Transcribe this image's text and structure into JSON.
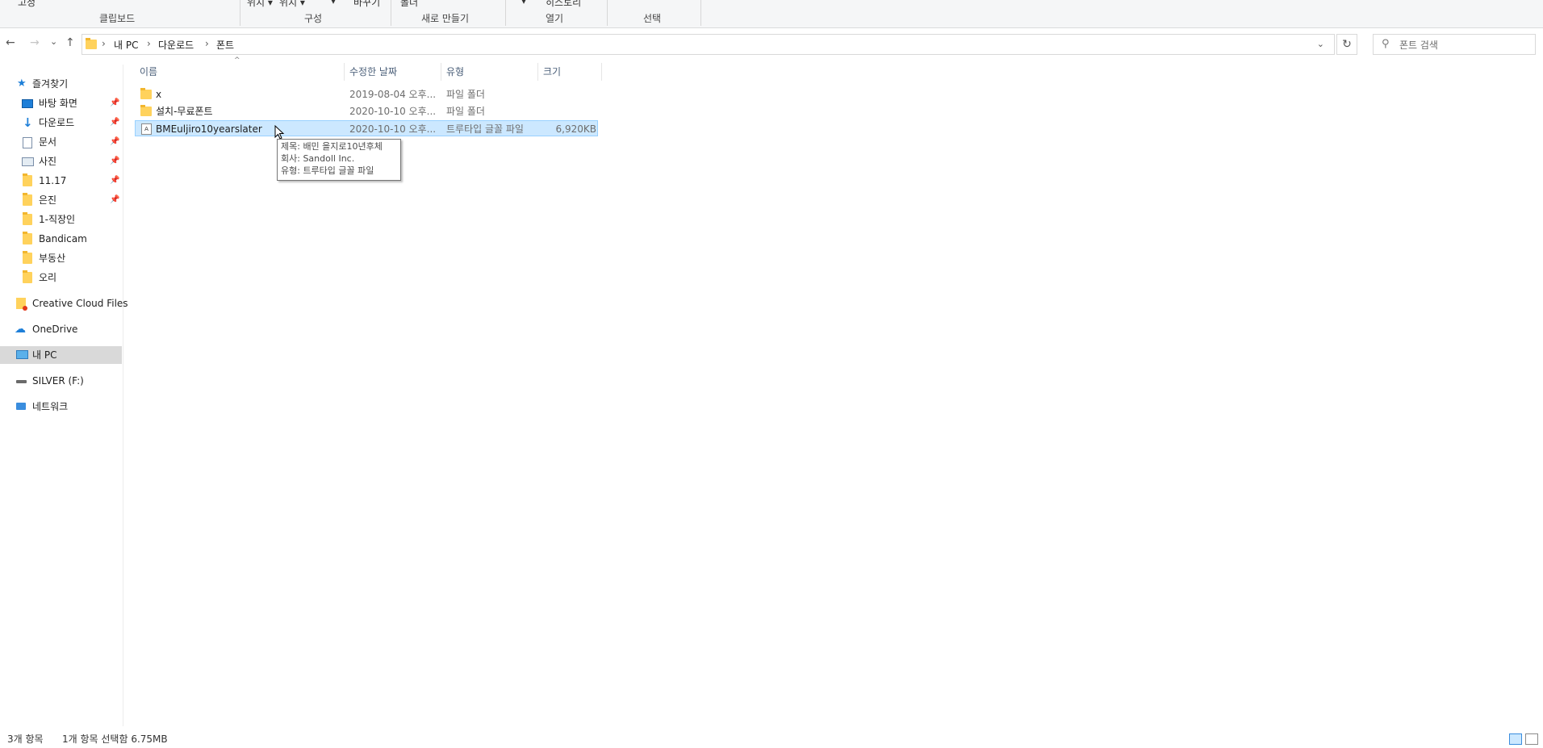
{
  "ribbon": {
    "top_items": [
      "고정",
      "위치 ▾",
      "위치 ▾",
      "▾",
      "바꾸기",
      "폴더",
      "▾",
      "히스토리"
    ],
    "groups": [
      {
        "label": "클립보드"
      },
      {
        "label": "구성"
      },
      {
        "label": "새로 만들기"
      },
      {
        "label": "열기"
      },
      {
        "label": "선택"
      }
    ]
  },
  "nav": {
    "back_icon": "←",
    "forward_icon": "→",
    "recent_icon": "⌄",
    "up_icon": "↑",
    "refresh_icon": "↻"
  },
  "address": {
    "crumbs": [
      "내 PC",
      "다운로드",
      "폰트"
    ],
    "separator": "›"
  },
  "search": {
    "placeholder": "폰트 검색",
    "value": ""
  },
  "sidebar": {
    "quick_access": "즐겨찾기",
    "items": [
      {
        "label": "바탕 화면",
        "icon": "desktop-icon",
        "pinned": true
      },
      {
        "label": "다운로드",
        "icon": "download-icon",
        "pinned": true
      },
      {
        "label": "문서",
        "icon": "document-icon",
        "pinned": true
      },
      {
        "label": "사진",
        "icon": "picture-icon",
        "pinned": true
      },
      {
        "label": "11.17",
        "icon": "folder-icon",
        "pinned": true
      },
      {
        "label": "은진",
        "icon": "folder-icon",
        "pinned": true
      },
      {
        "label": "1-직장인",
        "icon": "folder-icon",
        "pinned": false
      },
      {
        "label": "Bandicam",
        "icon": "folder-icon",
        "pinned": false
      },
      {
        "label": "부동산",
        "icon": "folder-icon",
        "pinned": false
      },
      {
        "label": "오리",
        "icon": "folder-icon",
        "pinned": false
      }
    ],
    "creative_cloud": "Creative Cloud Files",
    "onedrive": "OneDrive",
    "this_pc": "내 PC",
    "drive": "SILVER (F:)",
    "network": "네트워크"
  },
  "columns": {
    "name": "이름",
    "modified": "수정한 날짜",
    "type": "유형",
    "size": "크기"
  },
  "files": [
    {
      "name": "x",
      "modified": "2019-08-04 오후...",
      "type": "파일 폴더",
      "size": "",
      "kind": "folder",
      "selected": false
    },
    {
      "name": "설치-무료폰트",
      "modified": "2020-10-10 오후...",
      "type": "파일 폴더",
      "size": "",
      "kind": "folder",
      "selected": false
    },
    {
      "name": "BMEuljiro10yearslater",
      "modified": "2020-10-10 오후...",
      "type": "트루타입 글꼴 파일",
      "size": "6,920KB",
      "kind": "font",
      "selected": true
    }
  ],
  "tooltip": {
    "line1": "제목: 배민 을지로10년후체",
    "line2": "회사: Sandoll Inc.",
    "line3": "유형: 트루타입 글꼴 파일"
  },
  "status": {
    "item_count": "3개 항목",
    "selection": "1개 항목 선택함 6.75MB"
  },
  "colors": {
    "selection_bg": "#cce8ff",
    "selection_border": "#99d1ff",
    "folder": "#ffd25c",
    "accent": "#1e7fd8"
  }
}
